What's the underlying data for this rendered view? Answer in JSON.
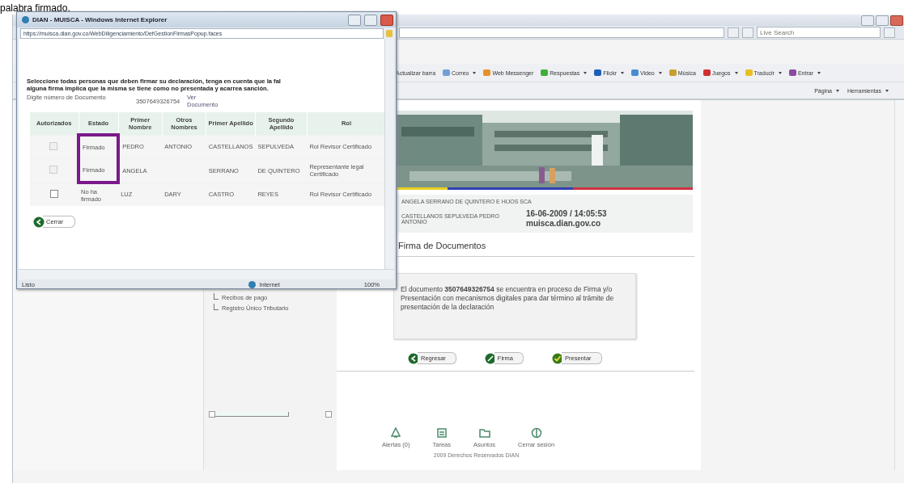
{
  "document_text": "palabra firmado.",
  "browser": {
    "search": {
      "placeholder": "Live Search"
    },
    "toolbar": [
      {
        "label": "Actualizar barra",
        "dropdown": false
      },
      {
        "label": "Correo",
        "dropdown": true,
        "color": "#6fa0d8"
      },
      {
        "label": "Web Messenger",
        "dropdown": false,
        "color": "#e8902a"
      },
      {
        "label": "Respuestas",
        "dropdown": true,
        "color": "#3fae3a"
      },
      {
        "label": "Flickr",
        "dropdown": true,
        "color": "#1c5fb8"
      },
      {
        "label": "Video",
        "dropdown": true,
        "color": "#4a8ad0"
      },
      {
        "label": "Música",
        "dropdown": false,
        "color": "#c8a030"
      },
      {
        "label": "Juegos",
        "dropdown": true,
        "color": "#d03030"
      },
      {
        "label": "Traducir",
        "dropdown": true,
        "color": "#e8c020"
      },
      {
        "label": "Entrar",
        "dropdown": true,
        "color": "#8a4aa0"
      }
    ],
    "command_bar": [
      {
        "label": "Página"
      },
      {
        "label": "Herramientas"
      }
    ]
  },
  "sidebar": {
    "items": [
      {
        "label": "Recibos de pago"
      },
      {
        "label": "Registro Único Tributario"
      }
    ]
  },
  "header": {
    "company": "ANGELA SERRANO DE QUINTERO E HIJOS SCA",
    "user": "CASTELLANOS SEPULVEDA PEDRO ANTONIO",
    "datetime": "16-06-2009 / 14:05:53",
    "site": "muisca.dian.gov.co"
  },
  "section_title": "Firma de Documentos",
  "message": "El documento **3507649326754** se encuentra en proceso de Firma y/o Presentación con mecanismos digitales para dar término al trámite de presentación de la declaración",
  "actions": [
    {
      "label": "Regresar",
      "kind": "back"
    },
    {
      "label": "Firma",
      "kind": "sign"
    },
    {
      "label": "Presentar",
      "kind": "submit"
    }
  ],
  "footer": {
    "links": [
      {
        "label": "Alertas (0)",
        "kind": "alerts"
      },
      {
        "label": "Tareas",
        "kind": "tasks"
      },
      {
        "label": "Asuntos",
        "kind": "folder"
      },
      {
        "label": "Cerrar sesión",
        "kind": "logout"
      }
    ],
    "copyright": "2009 Derechos Reservados DIAN"
  },
  "popup": {
    "title": "DIAN - MUISCA - Windows Internet Explorer",
    "address": "https://muisca.dian.gov.co/WebDiligenciamiento/DefGestionFirmasPopup.faces",
    "instructions": [
      "Seleccione todas personas que deben firmar su declaración, tenga en cuenta que la fal",
      "alguna firma implica que la misma se tiene como no presentada y acarrea sanción."
    ],
    "document_label": "Digite número de Documento",
    "document_number": "3507649326754",
    "view_link": "Ver Documento",
    "columns": [
      "Autorizados",
      "Estado",
      "Primer Nombre",
      "Otros Nombres",
      "Primer Apellido",
      "Segundo Apellido",
      "Rol"
    ],
    "rows": [
      {
        "checked": false,
        "disabled": true,
        "highlighted": true,
        "estado": "Firmado",
        "primer_nombre": "PEDRO",
        "otros_nombres": "ANTONIO",
        "primer_apellido": "CASTELLANOS",
        "segundo_apellido": "SEPULVEDA",
        "rol": "Rol Revisor Certificado"
      },
      {
        "checked": false,
        "disabled": true,
        "highlighted": true,
        "estado": "Firmado",
        "primer_nombre": "ANGELA",
        "otros_nombres": "",
        "primer_apellido": "SERRANO",
        "segundo_apellido": "DE QUINTERO",
        "rol": "Representante legal Certificado"
      },
      {
        "checked": false,
        "disabled": false,
        "highlighted": false,
        "estado": "No ha firmado",
        "primer_nombre": "LUZ",
        "otros_nombres": "DARY",
        "primer_apellido": "CASTRO",
        "segundo_apellido": "REYES",
        "rol": "Rol Revisor Certificado"
      }
    ],
    "close_button": "Cerrar",
    "status": {
      "text": "Listo",
      "zone": "Internet",
      "zoom": "100%"
    }
  }
}
